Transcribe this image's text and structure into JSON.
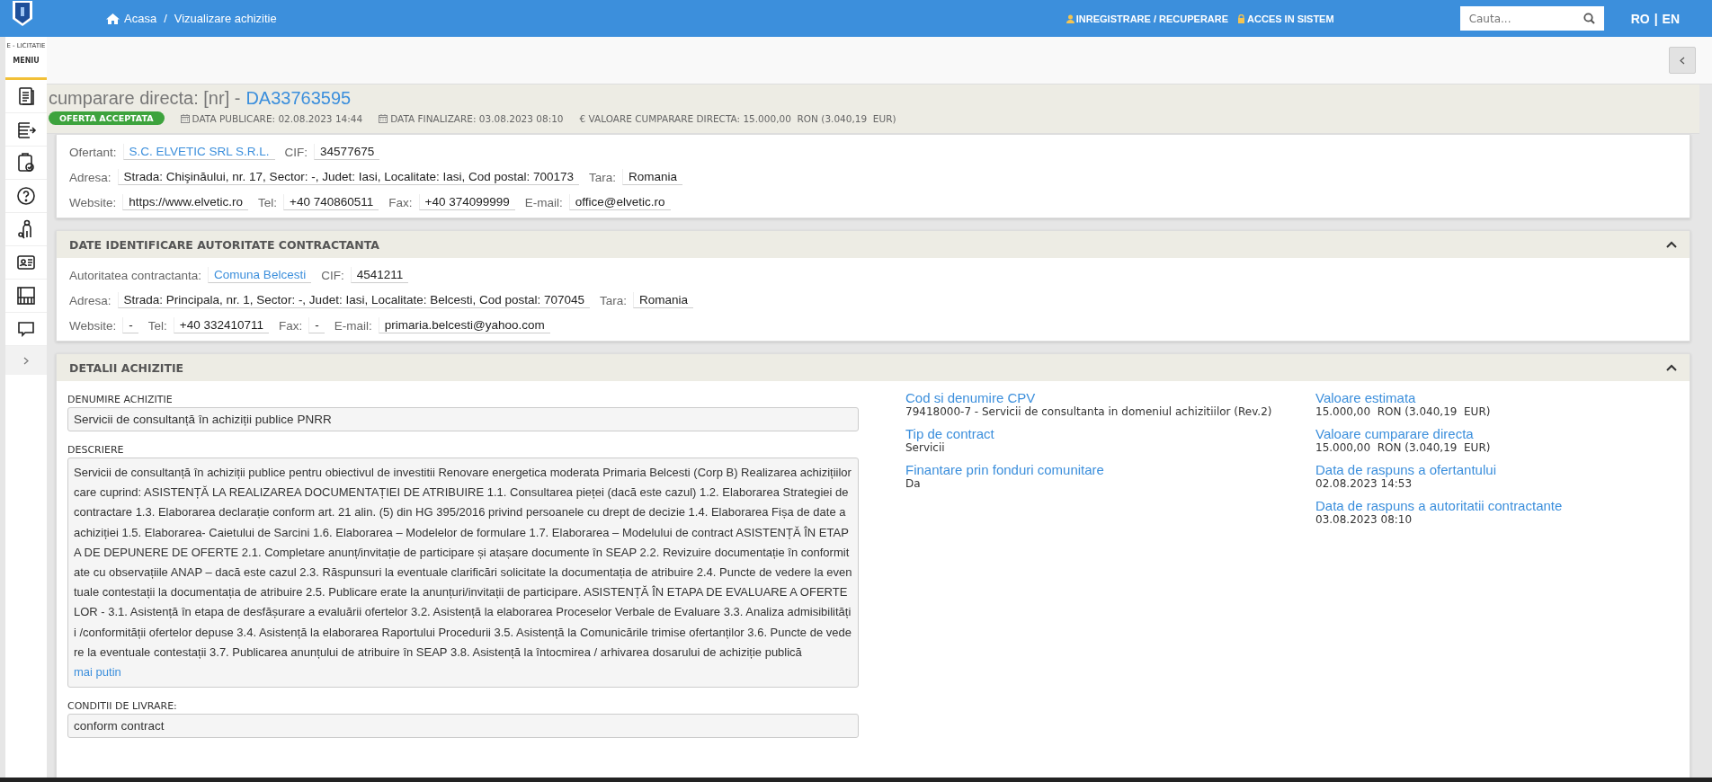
{
  "topbar": {
    "breadcrumb": [
      {
        "label": "Acasa",
        "kind": "home"
      },
      {
        "label": "Vizualizare achizitie",
        "kind": "page"
      }
    ],
    "separator": "/",
    "links": [
      {
        "label": "INREGISTRARE / RECUPERARE",
        "kind": "user"
      },
      {
        "label": "ACCES IN SISTEM",
        "kind": "lock"
      }
    ],
    "search": {
      "placeholder": "Cauta..."
    },
    "languages": [
      "RO",
      "EN"
    ],
    "language_separator": "|"
  },
  "sidebar": {
    "brand": "E - LICITATIE",
    "menu_label": "MENIU"
  },
  "header": {
    "title_prefix": "cumparare directa: [nr] -",
    "code": "DA33763595",
    "status": "OFERTA ACCEPTATA",
    "meta": [
      {
        "kind": "date",
        "text": "DATA PUBLICARE: 02.08.2023 14:44"
      },
      {
        "kind": "date",
        "text": "DATA FINALIZARE: 03.08.2023 08:10"
      },
      {
        "kind": "money",
        "text": "€ VALOARE CUMPARARE DIRECTA: 15.000,00  RON (3.040,19  EUR)"
      }
    ]
  },
  "offerer": {
    "lines": [
      {
        "fields": [
          {
            "label": "Ofertant:",
            "value": "S.C. ELVETIC SRL S.R.L.",
            "kind": "link"
          },
          {
            "label": "CIF:",
            "value": "34577675",
            "kind": "plain"
          }
        ]
      },
      {
        "fields": [
          {
            "label": "Adresa:",
            "value": "Strada: Chişinăului, nr. 17, Sector: -, Judet: Iasi, Localitate: Iasi, Cod postal: 700173",
            "kind": "plain"
          },
          {
            "label": "Tara:",
            "value": "Romania",
            "kind": "plain"
          }
        ]
      },
      {
        "fields": [
          {
            "label": "Website:",
            "value": "https://www.elvetic.ro",
            "kind": "plain"
          },
          {
            "label": "Tel:",
            "value": "+40 740860511",
            "kind": "plain"
          },
          {
            "label": "Fax:",
            "value": "+40 374099999",
            "kind": "plain"
          },
          {
            "label": "E-mail:",
            "value": "office@elvetic.ro",
            "kind": "plain"
          }
        ]
      }
    ]
  },
  "authority": {
    "title": "DATE IDENTIFICARE AUTORITATE CONTRACTANTA",
    "expanded": true,
    "lines": [
      {
        "fields": [
          {
            "label": "Autoritatea contractanta:",
            "value": "Comuna Belcesti",
            "kind": "link"
          },
          {
            "label": "CIF:",
            "value": "4541211",
            "kind": "plain"
          }
        ]
      },
      {
        "fields": [
          {
            "label": "Adresa:",
            "value": "Strada: Principala, nr. 1, Sector: -, Judet: Iasi, Localitate: Belcesti, Cod postal: 707045",
            "kind": "plain"
          },
          {
            "label": "Tara:",
            "value": "Romania",
            "kind": "plain"
          }
        ]
      },
      {
        "fields": [
          {
            "label": "Website:",
            "value": "-",
            "kind": "plain"
          },
          {
            "label": "Tel:",
            "value": "+40 332410711",
            "kind": "plain"
          },
          {
            "label": "Fax:",
            "value": "-",
            "kind": "plain"
          },
          {
            "label": "E-mail:",
            "value": "primaria.belcesti@yahoo.com",
            "kind": "plain"
          }
        ]
      }
    ]
  },
  "details": {
    "title": "DETALII ACHIZITIE",
    "expanded": true,
    "name_label": "DENUMIRE ACHIZITIE",
    "name_value": "Servicii de consultanță în achiziții publice PNRR",
    "description_label": "DESCRIERE",
    "description": "Servicii de consultanță în achiziții publice pentru obiectivul de investitii Renovare energetica moderata Primaria Belcesti (Corp B) Realizarea achizițiilor care cuprind: ASISTENȚĂ LA REALIZAREA DOCUMENTAȚIEI DE ATRIBUIRE 1.1. Consultarea pieței (dacă este cazul) 1.2. Elaborarea Strategiei de contractare 1.3. Elaborarea declarație conform art. 21 alin. (5) din HG 395/2016 privind persoanele cu drept de decizie 1.4. Elaborarea Fișa de date a achiziției 1.5. Elaborarea- Caietului de Sarcini 1.6. Elaborarea – Modelelor de formulare 1.7. Elaborarea – Modelului de contract ASISTENȚĂ ÎN ETAPA DE DEPUNERE DE OFERTE 2.1. Completare anunț/invitație de participare și atașare documente în SEAP 2.2. Revizuire documentație în conformitate cu observațiile ANAP – dacă este cazul 2.3. Răspunsuri la eventuale clarificări solicitate la documentația de atribuire 2.4. Puncte de vedere la eventuale contestații la documentația de atribuire 2.5. Publicare erate la anunțuri/invitații de participare. ASISTENȚĂ ÎN ETAPA DE EVALUARE A OFERTELOR - 3.1. Asistență în etapa de desfășurare a evaluării ofertelor 3.2. Asistență la elaborarea Proceselor Verbale de Evaluare 3.3. Analiza admisibilității /conformității ofertelor depuse 3.4. Asistență la elaborarea Raportului Procedurii 3.5. Asistență la Comunicările trimise ofertanților 3.6. Puncte de vedere la eventuale contestații 3.7. Publicarea anunțului de atribuire în SEAP 3.8. Asistență la întocmirea / arhivarea dosarului de achiziție publică",
    "less_link": "mai putin",
    "delivery_label": "CONDITII DE LIVRARE:",
    "delivery_value": "conform contract",
    "info_left": [
      {
        "label": "Cod si denumire CPV",
        "value": "79418000-7 - Servicii de consultanta in domeniul achizitiilor (Rev.2)"
      },
      {
        "label": "Tip de contract",
        "value": "Servicii"
      },
      {
        "label": "Finantare prin fonduri comunitare",
        "value": "Da"
      }
    ],
    "info_right": [
      {
        "label": "Valoare estimata",
        "value": "15.000,00  RON (3.040,19  EUR)"
      },
      {
        "label": "Valoare cumparare directa",
        "value": "15.000,00  RON (3.040,19  EUR)"
      },
      {
        "label": "Data de raspuns a ofertantului",
        "value": "02.08.2023 14:53"
      },
      {
        "label": "Data de raspuns a autoritatii contractante",
        "value": "03.08.2023 08:10"
      }
    ]
  }
}
